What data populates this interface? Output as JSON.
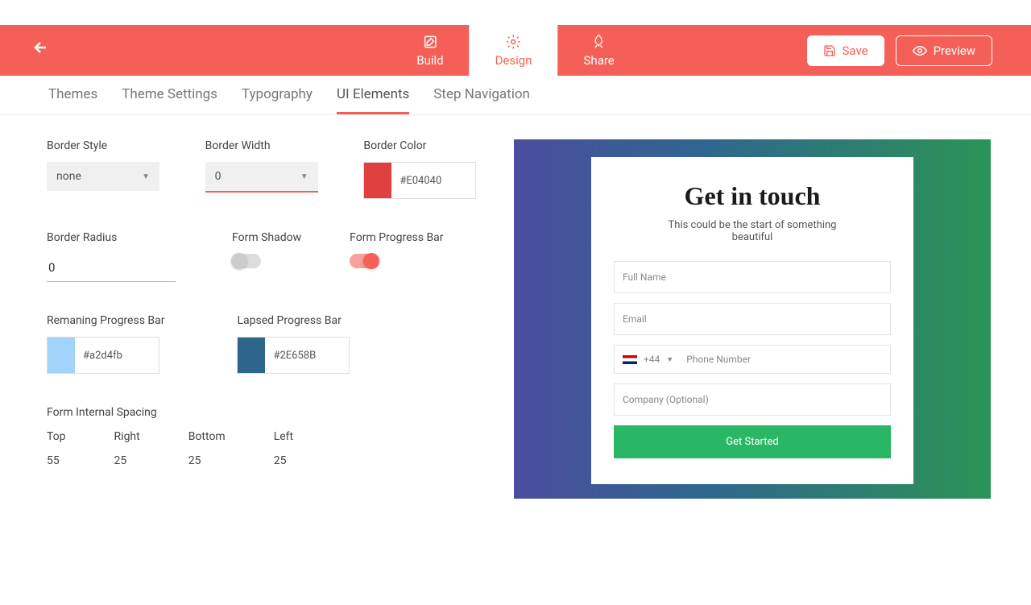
{
  "header": {
    "tabs": {
      "build": "Build",
      "design": "Design",
      "share": "Share"
    },
    "save": "Save",
    "preview": "Preview"
  },
  "subtabs": {
    "themes": "Themes",
    "theme_settings": "Theme Settings",
    "typography": "Typography",
    "ui_elements": "UI Elements",
    "step_nav": "Step Navigation"
  },
  "panel": {
    "border_style_label": "Border Style",
    "border_style_value": "none",
    "border_width_label": "Border Width",
    "border_width_value": "0",
    "border_color_label": "Border Color",
    "border_color_hex": "#E04040",
    "border_radius_label": "Border Radius",
    "border_radius_value": "0",
    "form_shadow_label": "Form Shadow",
    "form_progress_label": "Form Progress Bar",
    "remaining_label": "Remaning Progress Bar",
    "remaining_hex": "#a2d4fb",
    "lapsed_label": "Lapsed Progress Bar",
    "lapsed_hex": "#2E658B",
    "spacing_title": "Form Internal Spacing",
    "spacing": {
      "top_label": "Top",
      "top_val": "55",
      "right_label": "Right",
      "right_val": "25",
      "bottom_label": "Bottom",
      "bottom_val": "25",
      "left_label": "Left",
      "left_val": "25"
    }
  },
  "preview": {
    "title": "Get in touch",
    "subtitle": "This could be the start of something beautiful",
    "full_name": "Full Name",
    "email": "Email",
    "dial": "+44",
    "phone": "Phone Number",
    "company": "Company (Optional)",
    "cta": "Get Started"
  }
}
